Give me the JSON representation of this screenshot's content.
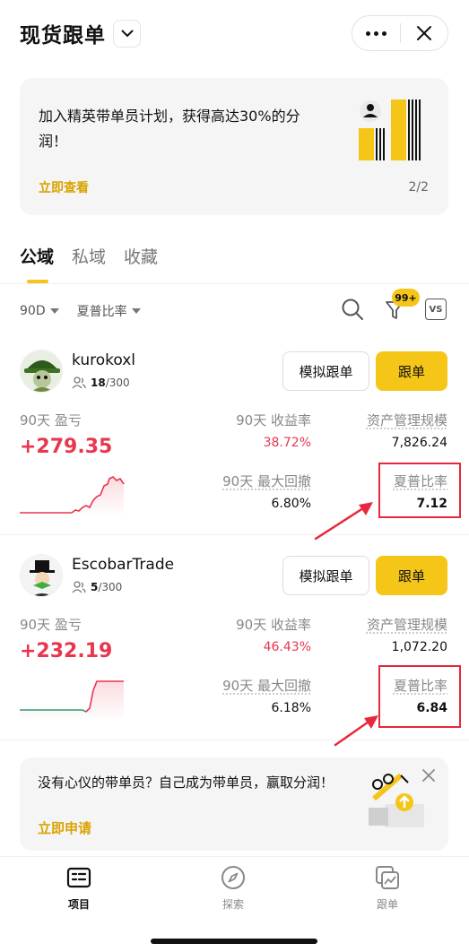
{
  "header": {
    "title": "现货跟单",
    "dropdown_icon": "chevron-down-icon",
    "more_icon": "more-dots-icon",
    "close_icon": "close-icon"
  },
  "banner": {
    "text": "加入精英带单员计划，获得高达30%的分润！",
    "link": "立即查看",
    "page": "2/2"
  },
  "tabs": [
    {
      "label": "公域",
      "active": true
    },
    {
      "label": "私域",
      "active": false
    },
    {
      "label": "收藏",
      "active": false
    }
  ],
  "filters": {
    "period": "90D",
    "sort": "夏普比率",
    "badge": "99+",
    "vs_label": "VS"
  },
  "buttons": {
    "simulate": "模拟跟单",
    "follow": "跟单"
  },
  "traders": [
    {
      "name": "kurokoxl",
      "followers_current": "18",
      "followers_max": "/300",
      "pnl_label": "90天 盈亏",
      "pnl": "+279.35",
      "roi_label": "90天 收益率",
      "roi": "38.72%",
      "aum_label": "资产管理规模",
      "aum": "7,826.24",
      "mdd_label": "90天 最大回撤",
      "mdd": "6.80%",
      "sharpe_label": "夏普比率",
      "sharpe": "7.12"
    },
    {
      "name": "EscobarTrade",
      "followers_current": "5",
      "followers_max": "/300",
      "pnl_label": "90天 盈亏",
      "pnl": "+232.19",
      "roi_label": "90天 收益率",
      "roi": "46.43%",
      "aum_label": "资产管理规模",
      "aum": "1,072.20",
      "mdd_label": "90天 最大回撤",
      "mdd": "6.18%",
      "sharpe_label": "夏普比率",
      "sharpe": "6.84"
    }
  ],
  "promo": {
    "text": "没有心仪的带单员？自己成为带单员，赢取分润！",
    "link": "立即申请"
  },
  "tabbar": [
    {
      "label": "项目",
      "icon": "list-icon",
      "active": true
    },
    {
      "label": "探索",
      "icon": "compass-icon",
      "active": false
    },
    {
      "label": "跟单",
      "icon": "copy-trade-icon",
      "active": false
    }
  ],
  "colors": {
    "accent": "#f5c518",
    "positive": "#e8364f",
    "highlight": "#e8283c"
  }
}
